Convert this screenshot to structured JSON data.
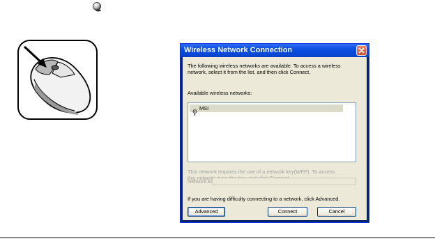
{
  "dialog": {
    "title": "Wireless Network Connection",
    "intro_line1": "The following wireless networks are available. To access a wireless",
    "intro_line2": "network, select it from the list, and then click Connect.",
    "available_label": "Available wireless networks:",
    "networks": [
      {
        "name": "MSI"
      }
    ],
    "key_note_line1": "This network requires the use of a network key(WEP). To access",
    "key_note_line2": "this network, type the key, and click Connect.",
    "network_key_label": "Network key:",
    "network_key_value": "",
    "help_text": "If you are having difficulty connecting to a network, click Advanced.",
    "advanced_label": "Advanced",
    "connect_label": "Connect",
    "cancel_label": "Cancel"
  },
  "icons": {
    "bullet": "bullet-sphere-icon",
    "mouse": "mouse-left-click-icon",
    "wifi": "wireless-network-icon",
    "close": "close-icon"
  },
  "colors": {
    "titlebar": "#0a4ee0",
    "dialog_bg": "#ece9d8",
    "close": "#d24f2a"
  }
}
